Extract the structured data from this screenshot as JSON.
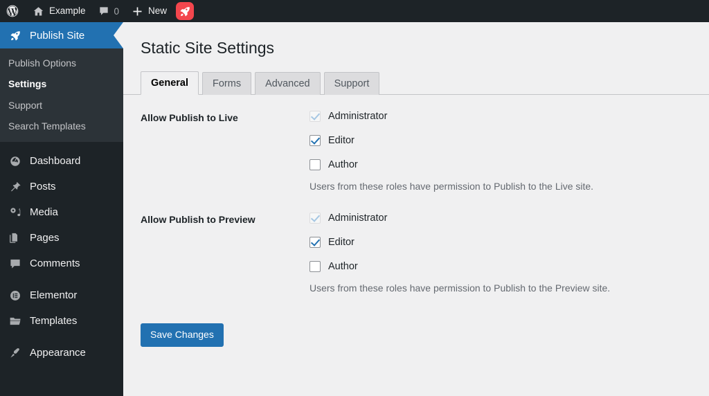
{
  "adminbar": {
    "wp_logo": "wordpress-logo-icon",
    "site": {
      "icon": "home-icon",
      "label": "Example"
    },
    "comments": {
      "icon": "comment-bubble-icon",
      "count": "0"
    },
    "new": {
      "icon": "plus-icon",
      "label": "New"
    },
    "rocket": {
      "icon": "rocket-icon",
      "color": "#f3464d"
    }
  },
  "sidebar": {
    "current": {
      "icon": "rocket-icon",
      "label": "Publish Site",
      "color": "#2271b1",
      "submenu": [
        {
          "label": "Publish Options",
          "current": false
        },
        {
          "label": "Settings",
          "current": true
        },
        {
          "label": "Support",
          "current": false
        },
        {
          "label": "Search Templates",
          "current": false
        }
      ]
    },
    "items": [
      {
        "icon": "dashboard-icon",
        "label": "Dashboard"
      },
      {
        "icon": "pin-icon",
        "label": "Posts"
      },
      {
        "icon": "media-icon",
        "label": "Media"
      },
      {
        "icon": "pages-icon",
        "label": "Pages"
      },
      {
        "icon": "comment-icon",
        "label": "Comments"
      },
      {
        "icon": "elementor-icon",
        "label": "Elementor"
      },
      {
        "icon": "folder-icon",
        "label": "Templates"
      },
      {
        "icon": "paintbrush-icon",
        "label": "Appearance"
      }
    ]
  },
  "main": {
    "title": "Static Site Settings",
    "tabs": [
      {
        "label": "General",
        "active": true
      },
      {
        "label": "Forms",
        "active": false
      },
      {
        "label": "Advanced",
        "active": false
      },
      {
        "label": "Support",
        "active": false
      }
    ],
    "fields": [
      {
        "label": "Allow Publish to Live",
        "options": [
          {
            "label": "Administrator",
            "checked": true,
            "disabled": true
          },
          {
            "label": "Editor",
            "checked": true,
            "disabled": false
          },
          {
            "label": "Author",
            "checked": false,
            "disabled": false
          }
        ],
        "description": "Users from these roles have permission to Publish to the Live site."
      },
      {
        "label": "Allow Publish to Preview",
        "options": [
          {
            "label": "Administrator",
            "checked": true,
            "disabled": true
          },
          {
            "label": "Editor",
            "checked": true,
            "disabled": false
          },
          {
            "label": "Author",
            "checked": false,
            "disabled": false
          }
        ],
        "description": "Users from these roles have permission to Publish to the Preview site."
      }
    ],
    "save_label": "Save Changes"
  },
  "colors": {
    "admin_bar": "#1d2327",
    "sidebar": "#1d2327",
    "submenu": "#2c3338",
    "accent": "#2271b1",
    "content_bg": "#f0f0f1",
    "rocket_red": "#f3464d"
  }
}
